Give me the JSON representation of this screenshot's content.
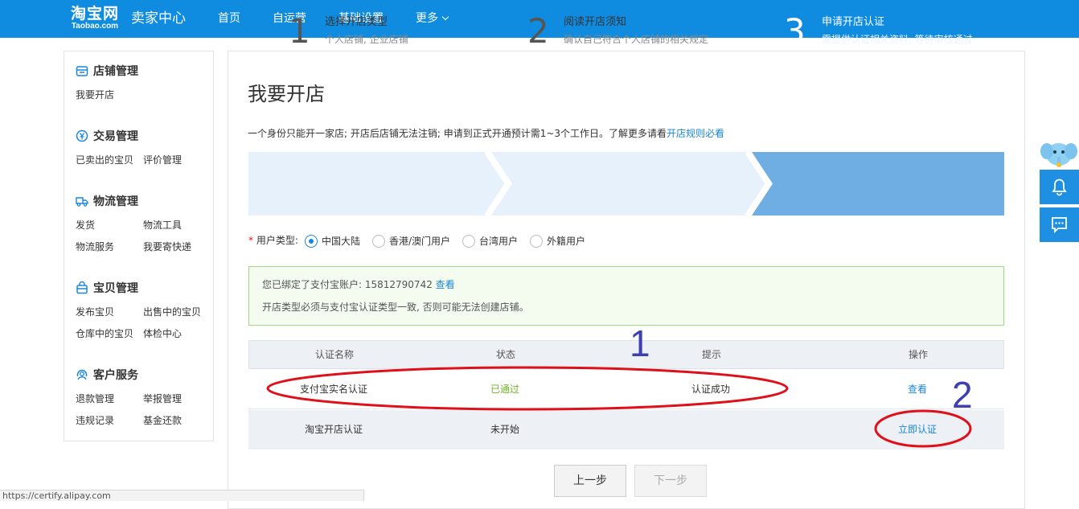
{
  "header": {
    "logo_main": "淘宝网",
    "logo_sub": "Taobao.com",
    "center_title": "卖家中心",
    "nav": [
      "首页",
      "自运营",
      "基础设置",
      "更多"
    ]
  },
  "sidebar": {
    "groups": [
      {
        "title": "店铺管理",
        "links": [
          "我要开店"
        ]
      },
      {
        "title": "交易管理",
        "links": [
          "已卖出的宝贝",
          "评价管理"
        ]
      },
      {
        "title": "物流管理",
        "links": [
          "发货",
          "物流工具",
          "物流服务",
          "我要寄快递"
        ]
      },
      {
        "title": "宝贝管理",
        "links": [
          "发布宝贝",
          "出售中的宝贝",
          "仓库中的宝贝",
          "体检中心"
        ]
      },
      {
        "title": "客户服务",
        "links": [
          "退款管理",
          "举报管理",
          "违规记录",
          "基金还款"
        ]
      }
    ]
  },
  "main": {
    "title": "我要开店",
    "notice_text": "一个身份只能开一家店; 开店后店铺无法注销; 申请到正式开通预计需1~3个工作日。了解更多请看",
    "notice_link": "开店规则必看",
    "steps": [
      {
        "num": "1",
        "title": "选择开店类型",
        "desc": "个人店铺, 企业店铺"
      },
      {
        "num": "2",
        "title": "阅读开店须知",
        "desc": "确认自己符合个人店铺的相关规定"
      },
      {
        "num": "3",
        "title": "申请开店认证",
        "desc": "需提供认证相关资料, 等待审核通过"
      }
    ],
    "user_type": {
      "required_mark": "*",
      "label": "用户类型:",
      "options": [
        "中国大陆",
        "香港/澳门用户",
        "台湾用户",
        "外籍用户"
      ],
      "selected": "中国大陆"
    },
    "info": {
      "line1_text": "您已绑定了支付宝账户: 15812790742",
      "line1_link": "查看",
      "line2": "开店类型必须与支付宝认证类型一致, 否则可能无法创建店铺。"
    },
    "table": {
      "headers": [
        "认证名称",
        "状态",
        "提示",
        "操作"
      ],
      "rows": [
        {
          "name": "支付宝实名认证",
          "status": "已通过",
          "hint": "认证成功",
          "action": "查看"
        },
        {
          "name": "淘宝开店认证",
          "status": "未开始",
          "hint": "",
          "action": "立即认证"
        }
      ]
    },
    "buttons": {
      "prev": "上一步",
      "next": "下一步"
    }
  },
  "annotations": {
    "one": "1",
    "two": "2"
  },
  "status_url": "https://certify.alipay.com",
  "colors": {
    "brand": "#0f8ce0",
    "link": "#1a86d8",
    "success": "#6fb327",
    "annotation_circle": "#e0101a",
    "annotation_number": "#3f3fb4"
  }
}
